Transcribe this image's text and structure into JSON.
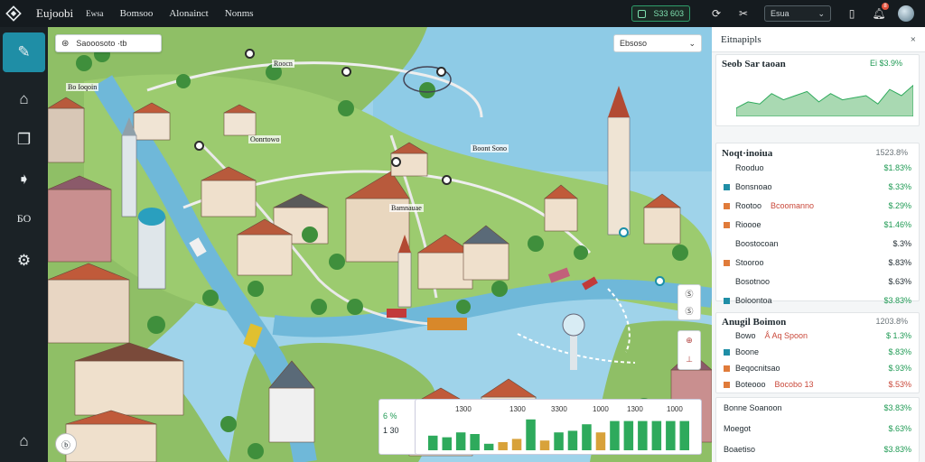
{
  "app": {
    "title": "Eujoobi",
    "logo_icon": "diamond-logo-icon"
  },
  "menu": [
    "Bomsoo",
    "Alonainct",
    "Nonms"
  ],
  "menu_small": "Ewsa",
  "topbar": {
    "status_label": "S33 603",
    "search_value": "Esua",
    "notification_count": "8"
  },
  "rail": {
    "items": [
      {
        "icon": "chat-icon",
        "active": true
      },
      {
        "icon": "home-icon"
      },
      {
        "icon": "layers-icon"
      },
      {
        "icon": "tag-icon"
      },
      {
        "icon": "text-icon",
        "text": "ƂO"
      },
      {
        "icon": "gear-icon"
      }
    ],
    "bottom_icon": "building-icon"
  },
  "map": {
    "search_placeholder": "Saooosoto ·tb",
    "layer_select": "Ebsoso",
    "labels": [
      "Roocn",
      "Bo Ioqoin",
      "Oonrtowo",
      "Boont Sono",
      "Bamnauae"
    ],
    "zoom_labels": [
      "Ⓢ",
      "Ⓢ"
    ],
    "alert_labels": [
      "⊕",
      "⊥"
    ],
    "legend": [
      {
        "text": "6 %",
        "color": "g"
      },
      {
        "text": "1 30",
        "color": ""
      }
    ],
    "bar_labels": [
      "1300",
      "1300",
      "3300",
      "1000",
      "1300",
      "1000"
    ],
    "bars": [
      {
        "v": 0.45,
        "c": "#2eaa5c"
      },
      {
        "v": 0.4,
        "c": "#2eaa5c"
      },
      {
        "v": 0.55,
        "c": "#2eaa5c"
      },
      {
        "v": 0.5,
        "c": "#2eaa5c"
      },
      {
        "v": 0.2,
        "c": "#2eaa5c"
      },
      {
        "v": 0.25,
        "c": "#d8a23a"
      },
      {
        "v": 0.35,
        "c": "#d8a23a"
      },
      {
        "v": 0.95,
        "c": "#2eaa5c"
      },
      {
        "v": 0.3,
        "c": "#d8a23a"
      },
      {
        "v": 0.55,
        "c": "#2eaa5c"
      },
      {
        "v": 0.6,
        "c": "#2eaa5c"
      },
      {
        "v": 0.8,
        "c": "#2eaa5c"
      },
      {
        "v": 0.55,
        "c": "#d8a23a"
      },
      {
        "v": 0.9,
        "c": "#2eaa5c"
      },
      {
        "v": 0.9,
        "c": "#2eaa5c"
      },
      {
        "v": 0.9,
        "c": "#2eaa5c"
      },
      {
        "v": 0.9,
        "c": "#2eaa5c"
      },
      {
        "v": 0.9,
        "c": "#2eaa5c"
      },
      {
        "v": 0.9,
        "c": "#2eaa5c"
      }
    ]
  },
  "panel": {
    "title": "Eitnapipls",
    "card1": {
      "title": "Seob Sar taoan",
      "value": "Ei $3.9%",
      "chart": [
        0.2,
        0.35,
        0.3,
        0.55,
        0.4,
        0.5,
        0.6,
        0.35,
        0.55,
        0.4,
        0.45,
        0.5,
        0.3,
        0.65,
        0.5,
        0.75
      ]
    },
    "card2": {
      "title": "Noqt·inoiua",
      "title_value": "1523.8%",
      "rows": [
        {
          "label": "Rooduo",
          "value": "$1.83%",
          "sq": "",
          "vc": "g"
        },
        {
          "label": "Bonsnoao",
          "value": "$.33%",
          "sq": "#1f8ea6",
          "vc": "g"
        },
        {
          "label": "Rootoo",
          "extra": "Bcoomanno",
          "value": "$.29%",
          "sq": "#e07b3a",
          "vc": "g"
        },
        {
          "label": "Rioooe",
          "value": "$1.46%",
          "sq": "#e07b3a",
          "vc": "g"
        },
        {
          "label": "Boostocoan",
          "value": "$.3%",
          "sq": "",
          "vc": ""
        },
        {
          "label": "Stooroo",
          "value": "$.83%",
          "sq": "#e07b3a",
          "vc": ""
        },
        {
          "label": "Bosotnoo",
          "value": "$.63%",
          "sq": "",
          "vc": ""
        },
        {
          "label": "Boloontoa",
          "value": "$3.83%",
          "sq": "#1f8ea6",
          "vc": "g"
        }
      ]
    },
    "card3": {
      "title": "Anugil Boimon",
      "title_value": "1203.8%",
      "rows": [
        {
          "label": "Bowo",
          "extra": "Ǻ Aq Spoon",
          "value": "$ 1.3%",
          "sq": "",
          "vc": "g"
        },
        {
          "label": "Boone",
          "value": "$.83%",
          "sq": "#1f8ea6",
          "vc": "g"
        },
        {
          "label": "Beqocnitsao",
          "value": "$.93%",
          "sq": "#e07b3a",
          "vc": "g"
        },
        {
          "label": "Boteooo",
          "extra": "Bocobo 13",
          "value": "$.53%",
          "sq": "#e07b3a",
          "vc": "r"
        }
      ]
    },
    "card4": {
      "rows": [
        {
          "label": "Bonne Soanoon",
          "value": "$3.83%",
          "vc": "g"
        },
        {
          "label": "Moegot",
          "value": "$.63%",
          "vc": "g"
        },
        {
          "label": "Boaetiso",
          "value": "$3.83%",
          "vc": "g"
        }
      ]
    }
  }
}
